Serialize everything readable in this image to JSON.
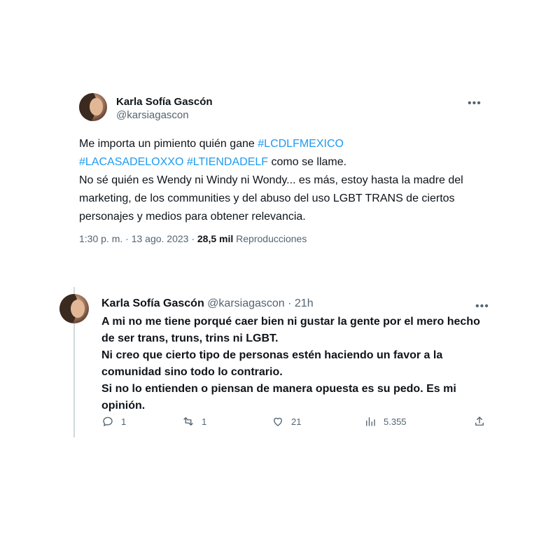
{
  "tweet1": {
    "display_name": "Karla Sofía Gascón",
    "handle": "@karsiagascon",
    "more_icon": "•••",
    "text_line1_plain": "Me importa un pimiento quién gane ",
    "hashtag1": "#LCDLFMEXICO",
    "hashtag2": "#LACASADELOXXO",
    "hashtag3": "#LTIENDADELF",
    "text_line2_tail": " como se llame.",
    "text_paragraph2": "No sé quién es Wendy ni Windy ni Wondy... es más, estoy hasta la madre del marketing, de los communities y del abuso del uso LGBT TRANS de ciertos personajes y medios para obtener relevancia.",
    "timestamp": "1:30 p. m. · 13 ago. 2023 · ",
    "views_count": "28,5 mil",
    "views_label": " Reproducciones"
  },
  "tweet2": {
    "display_name": "Karla Sofía Gascón",
    "handle": "@karsiagascon",
    "separator": " · ",
    "time_ago": "21h",
    "more_icon": "•••",
    "line1": "A mi no me tiene porqué caer bien ni gustar la gente por el mero hecho de ser trans, truns, trins ni LGBT.",
    "line2": "Ni creo que cierto tipo de personas estén haciendo un favor a la comunidad sino todo lo contrario.",
    "line3": "Si no lo entienden o piensan de manera opuesta es su pedo.  Es mi opinión.",
    "actions": {
      "replies": "1",
      "retweets": "1",
      "likes": "21",
      "views": "5.355"
    }
  },
  "colors": {
    "hashtag": "#1d9bf0",
    "secondary_text": "#536471",
    "primary_text": "#0f1419",
    "thread_line": "#cfd9de"
  }
}
